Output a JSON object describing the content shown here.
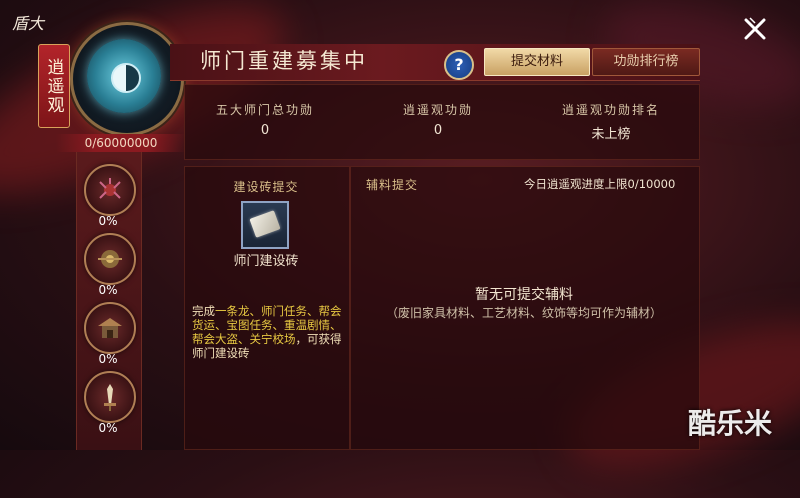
{
  "logo_text": "盾大",
  "sect": {
    "name": "逍遥观",
    "progress": "0/60000000",
    "progress_fraction": 0
  },
  "side_items": [
    {
      "icon": "spider-emblem-icon",
      "percent": "0%"
    },
    {
      "icon": "lion-bell-icon",
      "percent": "0%"
    },
    {
      "icon": "pavilion-icon",
      "percent": "0%"
    },
    {
      "icon": "sword-icon",
      "percent": "0%"
    }
  ],
  "header": {
    "title": "师门重建募集中",
    "help_label": "?",
    "tabs": [
      {
        "label": "提交材料",
        "active": true
      },
      {
        "label": "功勋排行榜",
        "active": false
      }
    ]
  },
  "stats": [
    {
      "label": "五大师门总功勋",
      "value": "0"
    },
    {
      "label": "逍遥观功勋",
      "value": "0"
    },
    {
      "label": "逍遥观功勋排名",
      "value": "未上榜"
    }
  ],
  "brick_panel": {
    "heading": "建设砖提交",
    "item_name": "师门建设砖",
    "desc_prefix": "完成",
    "desc_highlight_1": "一条龙、师门任务、",
    "desc_highlight_2": "帮会货运、宝图任务、重",
    "desc_highlight_3": "温剧情、帮会大盗、关宁",
    "desc_highlight_4": "校场",
    "desc_suffix": "，可获得师门建设砖"
  },
  "aux_panel": {
    "heading": "辅料提交",
    "limit_text": "今日逍遥观进度上限0/10000",
    "empty_title": "暂无可提交辅料",
    "empty_sub": "（废旧家具材料、工艺材料、纹饰等均可作为辅材）"
  },
  "watermark": "酷乐米",
  "colors": {
    "accent_gold": "#d9bf8a",
    "highlight_yellow": "#e7c842",
    "panel_red": "#6b1a1f"
  }
}
